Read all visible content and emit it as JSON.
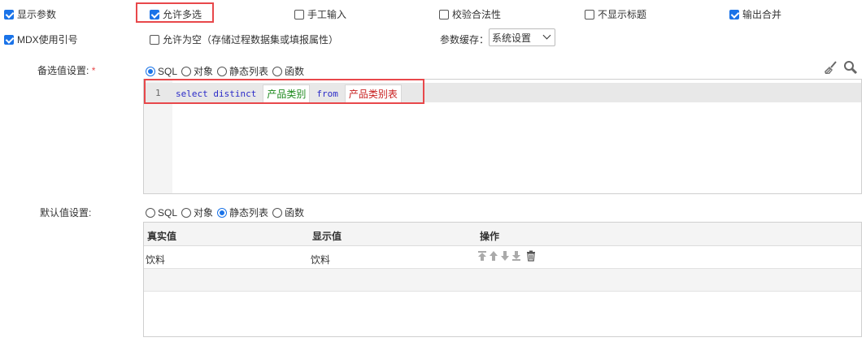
{
  "options": {
    "show_params": {
      "label": "显示参数",
      "checked": true
    },
    "allow_multi": {
      "label": "允许多选",
      "checked": true
    },
    "manual_input": {
      "label": "手工输入",
      "checked": false
    },
    "validate": {
      "label": "校验合法性",
      "checked": false
    },
    "hide_title": {
      "label": "不显示标题",
      "checked": false
    },
    "output_merge": {
      "label": "输出合并",
      "checked": true
    },
    "mdx_quote": {
      "label": "MDX使用引号",
      "checked": true
    },
    "allow_empty": {
      "label": "允许为空（存储过程数据集或填报属性）",
      "checked": false
    }
  },
  "param_cache": {
    "label": "参数缓存：",
    "value": "系统设置"
  },
  "candidate": {
    "label": "备选值设置:",
    "required_mark": "*",
    "radios": [
      "SQL",
      "对象",
      "静态列表",
      "函数"
    ],
    "selected": "SQL",
    "editor": {
      "line_no": "1",
      "kw_select": "select distinct",
      "token1": "产品类别",
      "kw_from": "from",
      "token2": "产品类别表"
    }
  },
  "default": {
    "label": "默认值设置:",
    "radios": [
      "SQL",
      "对象",
      "静态列表",
      "函数"
    ],
    "selected": "静态列表",
    "columns": [
      "真实值",
      "显示值",
      "操作"
    ],
    "rows": [
      {
        "real": "饮料",
        "display": "饮料"
      }
    ]
  },
  "icons": [
    "broom-icon",
    "search-icon",
    "move-top-icon",
    "move-up-icon",
    "move-down-icon",
    "move-bottom-icon",
    "trash-icon"
  ],
  "colors": {
    "accent": "#1a73e8",
    "highlight": "#e8484b",
    "keyword": "#2b2bc8",
    "field": "#1e8a1e",
    "table": "#c82020"
  }
}
